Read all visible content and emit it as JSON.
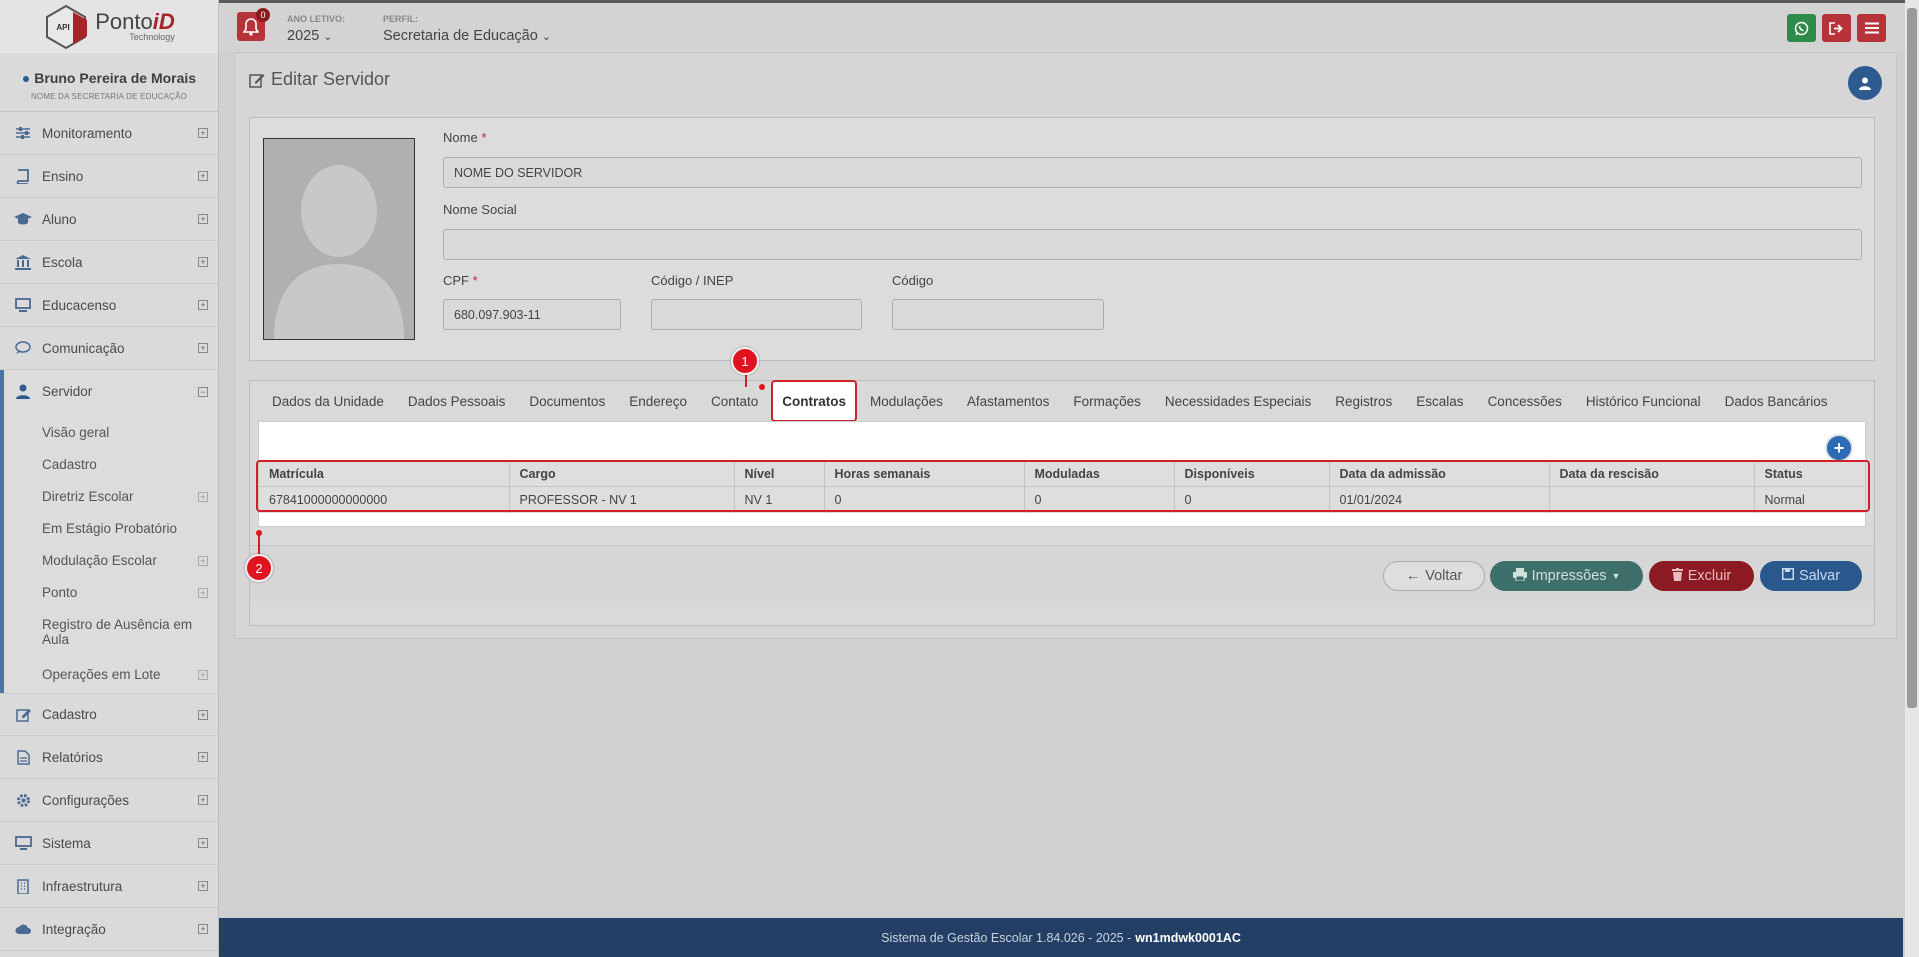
{
  "brand": {
    "logo_prefix": "Ponto",
    "logo_accent": "iD",
    "logo_sub": "Technology",
    "logo_badge": "API"
  },
  "user": {
    "name": "Bruno Pereira de Morais",
    "role": "NOME DA SECRETARIA DE EDUCAÇÃO"
  },
  "sidebar": {
    "items_top": [
      {
        "label": "Monitoramento",
        "icon": "sliders-icon"
      },
      {
        "label": "Ensino",
        "icon": "book-icon"
      },
      {
        "label": "Aluno",
        "icon": "graduation-cap-icon"
      },
      {
        "label": "Escola",
        "icon": "institution-icon"
      },
      {
        "label": "Educacenso",
        "icon": "monitor-icon"
      },
      {
        "label": "Comunicação",
        "icon": "chat-bubble-icon"
      }
    ],
    "servidor": {
      "label": "Servidor",
      "icon": "user-icon",
      "subitems": [
        {
          "label": "Visão geral"
        },
        {
          "label": "Cadastro"
        },
        {
          "label": "Diretriz Escolar"
        },
        {
          "label": "Em Estágio Probatório"
        },
        {
          "label": "Modulação Escolar"
        },
        {
          "label": "Ponto"
        },
        {
          "label": "Registro de Ausência em Aula"
        },
        {
          "label": "Operações em Lote"
        }
      ]
    },
    "items_bottom": [
      {
        "label": "Cadastro",
        "icon": "edit-icon"
      },
      {
        "label": "Relatórios",
        "icon": "file-icon"
      },
      {
        "label": "Configurações",
        "icon": "gear-icon"
      },
      {
        "label": "Sistema",
        "icon": "desktop-icon"
      },
      {
        "label": "Infraestrutura",
        "icon": "building-icon"
      },
      {
        "label": "Integração",
        "icon": "cloud-icon"
      }
    ]
  },
  "topbar": {
    "notifications": "0",
    "ano_letivo_label": "ANO LETIVO:",
    "ano_letivo_value": "2025",
    "perfil_label": "PERFIL:",
    "perfil_value": "Secretaria de Educação"
  },
  "page": {
    "title": "Editar Servidor"
  },
  "form": {
    "nome_label": "Nome",
    "nome_value": "NOME DO SERVIDOR",
    "nome_social_label": "Nome Social",
    "nome_social_value": "",
    "cpf_label": "CPF",
    "cpf_value": "680.097.903-11",
    "codigo_inep_label": "Código / INEP",
    "codigo_inep_value": "",
    "codigo_label": "Código",
    "codigo_value": "",
    "required_mark": "*"
  },
  "tabs": [
    {
      "label": "Dados da Unidade"
    },
    {
      "label": "Dados Pessoais"
    },
    {
      "label": "Documentos"
    },
    {
      "label": "Endereço"
    },
    {
      "label": "Contato"
    },
    {
      "label": "Contratos",
      "active": true
    },
    {
      "label": "Modulações"
    },
    {
      "label": "Afastamentos"
    },
    {
      "label": "Formações"
    },
    {
      "label": "Necessidades Especiais"
    },
    {
      "label": "Registros"
    },
    {
      "label": "Escalas"
    },
    {
      "label": "Concessões"
    },
    {
      "label": "Histórico Funcional"
    },
    {
      "label": "Dados Bancários"
    }
  ],
  "contracts": {
    "columns": [
      "Matrícula",
      "Cargo",
      "Nível",
      "Horas semanais",
      "Moduladas",
      "Disponíveis",
      "Data da admissão",
      "Data da rescisão",
      "Status"
    ],
    "rows": [
      [
        "67841000000000000",
        "PROFESSOR - NV 1",
        "NV 1",
        "0",
        "0",
        "0",
        "01/01/2024",
        "",
        "Normal"
      ]
    ],
    "add_label": "+"
  },
  "actions": {
    "voltar": "Voltar",
    "impressoes": "Impressões",
    "excluir": "Excluir",
    "salvar": "Salvar"
  },
  "markers": {
    "m1": "1",
    "m2": "2"
  },
  "footer": {
    "text": "Sistema de Gestão Escolar 1.84.026 - 2025 -",
    "code": "wn1mdwk0001AC"
  },
  "colors": {
    "primary": "#2d5a8f",
    "danger": "#b6333a",
    "success": "#2e8b4a",
    "footer": "#243f66",
    "highlight": "#d0202a"
  }
}
